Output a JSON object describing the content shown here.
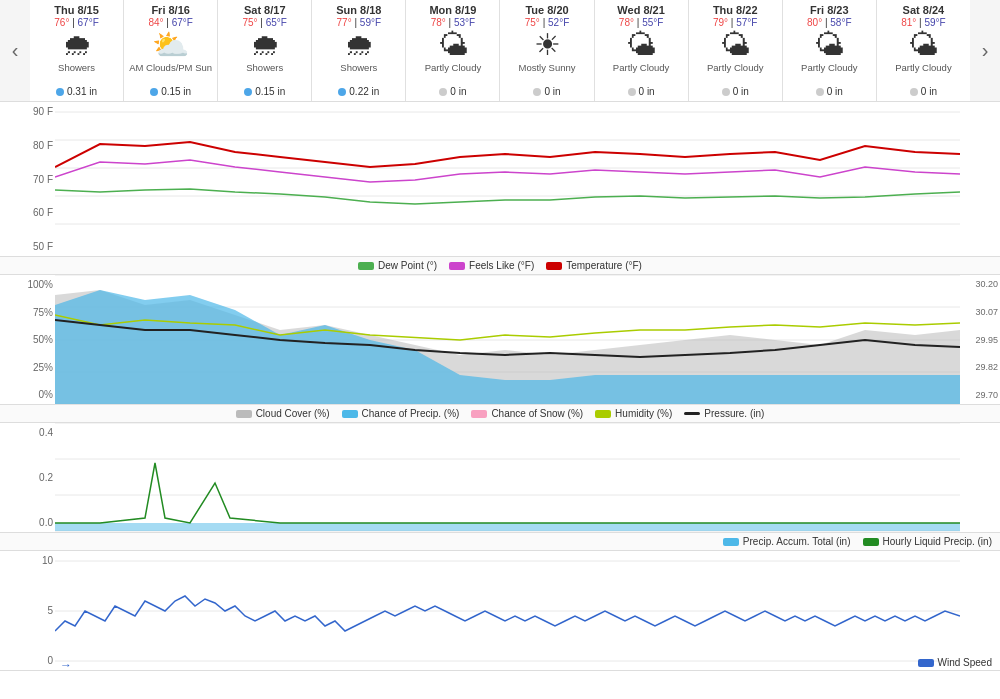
{
  "nav": {
    "prev_label": "‹",
    "next_label": "›"
  },
  "days": [
    {
      "label": "Thu 8/15",
      "hi": "76°",
      "lo": "67°F",
      "icon": "🌧",
      "condition": "Showers",
      "precip": "0.31 in",
      "precip_type": "blue"
    },
    {
      "label": "Fri 8/16",
      "hi": "84°",
      "lo": "67°F",
      "icon": "⛅",
      "condition": "AM Clouds/PM Sun",
      "precip": "0.15 in",
      "precip_type": "blue"
    },
    {
      "label": "Sat 8/17",
      "hi": "75°",
      "lo": "65°F",
      "icon": "🌧",
      "condition": "Showers",
      "precip": "0.15 in",
      "precip_type": "blue"
    },
    {
      "label": "Sun 8/18",
      "hi": "77°",
      "lo": "59°F",
      "icon": "🌧",
      "condition": "Showers",
      "precip": "0.22 in",
      "precip_type": "blue"
    },
    {
      "label": "Mon 8/19",
      "hi": "78°",
      "lo": "53°F",
      "icon": "🌤",
      "condition": "Partly Cloudy",
      "precip": "0 in",
      "precip_type": "gray"
    },
    {
      "label": "Tue 8/20",
      "hi": "75°",
      "lo": "52°F",
      "icon": "☀",
      "condition": "Mostly Sunny",
      "precip": "0 in",
      "precip_type": "gray"
    },
    {
      "label": "Wed 8/21",
      "hi": "78°",
      "lo": "55°F",
      "icon": "🌤",
      "condition": "Partly Cloudy",
      "precip": "0 in",
      "precip_type": "gray"
    },
    {
      "label": "Thu 8/22",
      "hi": "79°",
      "lo": "57°F",
      "icon": "🌤",
      "condition": "Partly Cloudy",
      "precip": "0 in",
      "precip_type": "gray"
    },
    {
      "label": "Fri 8/23",
      "hi": "80°",
      "lo": "58°F",
      "icon": "🌤",
      "condition": "Partly Cloudy",
      "precip": "0 in",
      "precip_type": "gray"
    },
    {
      "label": "Sat 8/24",
      "hi": "81°",
      "lo": "59°F",
      "icon": "🌤",
      "condition": "Partly Cloudy",
      "precip": "0 in",
      "precip_type": "gray"
    }
  ],
  "chart1": {
    "y_labels": [
      "90 F",
      "80 F",
      "70 F",
      "60 F",
      "50 F"
    ],
    "legend": [
      {
        "label": "Dew Point (°)",
        "color": "#4CAF50",
        "type": "line"
      },
      {
        "label": "Feels Like (°F)",
        "color": "#CC44CC",
        "type": "line"
      },
      {
        "label": "Temperature (°F)",
        "color": "#CC0000",
        "type": "line"
      }
    ]
  },
  "chart2": {
    "y_labels": [
      "100%",
      "75%",
      "50%",
      "25%",
      "0%"
    ],
    "right_labels": [
      "30.20",
      "30.07",
      "29.95",
      "29.82",
      "29.70"
    ],
    "legend": [
      {
        "label": "Cloud Cover (%)",
        "color": "#bbb",
        "type": "area"
      },
      {
        "label": "Chance of Precip. (%)",
        "color": "#4db8e8",
        "type": "area"
      },
      {
        "label": "Chance of Snow (%)",
        "color": "#f8a0c0",
        "type": "area"
      },
      {
        "label": "Humidity (%)",
        "color": "#aacc00",
        "type": "line"
      },
      {
        "label": "Pressure. (in)",
        "color": "#222",
        "type": "line"
      }
    ]
  },
  "chart3": {
    "y_labels": [
      "0.4",
      "0.2",
      "0.0"
    ],
    "legend": [
      {
        "label": "Precip. Accum. Total (in)",
        "color": "#4db8e8",
        "type": "area"
      },
      {
        "label": "Hourly Liquid Precip. (in)",
        "color": "#228B22",
        "type": "line"
      }
    ]
  },
  "chart4": {
    "y_labels": [
      "10",
      "5",
      "0"
    ],
    "legend": [
      {
        "label": "Wind Speed",
        "color": "#3366cc",
        "type": "line"
      }
    ],
    "arrow_label": "→"
  }
}
